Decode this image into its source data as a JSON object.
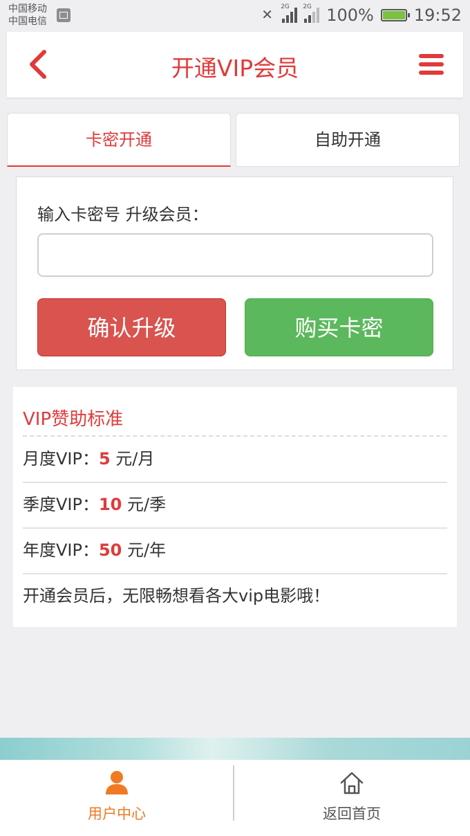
{
  "status_bar": {
    "carrier_1": "中国移动",
    "carrier_2": "中国电信",
    "network_1": "2G",
    "network_2": "2G",
    "battery": "100%",
    "time": "19:52"
  },
  "header": {
    "title": "开通VIP会员",
    "back_icon": "chevron-left-icon",
    "menu_icon": "hamburger-icon",
    "accent_color": "#e03a3a"
  },
  "tabs": [
    {
      "label": "卡密开通",
      "active": true
    },
    {
      "label": "自助开通",
      "active": false
    }
  ],
  "card_form": {
    "label": "输入卡密号 升级会员：",
    "input_value": "",
    "confirm_label": "确认升级",
    "buy_label": "购买卡密",
    "confirm_color": "#d9534f",
    "buy_color": "#5cb85c"
  },
  "pricing": {
    "title": "VIP赞助标准",
    "items": [
      {
        "name": "月度VIP：",
        "price": "5",
        "unit": " 元/月"
      },
      {
        "name": "季度VIP：",
        "price": "10",
        "unit": " 元/季"
      },
      {
        "name": "年度VIP：",
        "price": "50",
        "unit": " 元/年"
      }
    ],
    "note": "开通会员后，无限畅想看各大vip电影哦！"
  },
  "bottom_nav": [
    {
      "label": "用户中心",
      "icon": "user-icon",
      "active": true
    },
    {
      "label": "返回首页",
      "icon": "home-icon",
      "active": false
    }
  ]
}
